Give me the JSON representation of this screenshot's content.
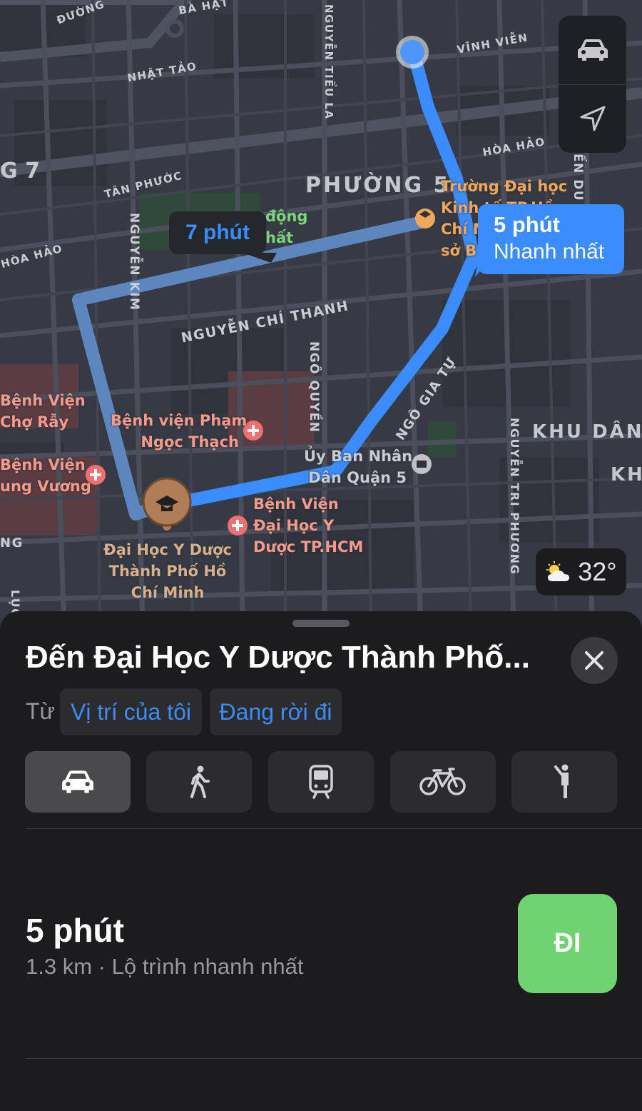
{
  "map": {
    "streets": {
      "duong": "ĐƯỜNG",
      "ba_hat": "BÀ HẠT",
      "nguyen_tieu_la": "NGUYỄN TIỂU LA",
      "vinh_vien": "VĨNH VIỄN",
      "nhat_tao": "NHẬT TẢO",
      "hoa_hao_right": "HÒA HẢO",
      "hoa_hao_left": "HÒA HẢO",
      "tan_phuoc": "TÂN PHƯỚC",
      "nguyen_kim": "NGUYỄN KIM",
      "nguyen_chi_thanh": "NGUYỄN CHÍ THANH",
      "ngo_quyen": "NGÔ QUYỀN",
      "ngo_gia_tu": "NGÔ GIA TỰ",
      "nguyen_tri_phuong": "NGUYỄN TRI PHƯƠNG",
      "en_du": "ẾN DU",
      "ng_left": "NG",
      "luc_left": "LỤC",
      "num7": "G 7"
    },
    "areas": {
      "phuong5": "PHƯỜNG 5",
      "khu_dan_c": "KHU DÂN C",
      "khu": "KHU"
    },
    "pois": {
      "bv_cho_ray": [
        "Bệnh Viện",
        "Chợ Rẫy"
      ],
      "bv_hung_vuong": [
        "Bệnh Viện",
        "ung Vương"
      ],
      "bv_pham_ngoc_thach": [
        "Bệnh viện Phạm",
        "Ngọc Thạch"
      ],
      "ubnd_q5": [
        "Ủy Ban Nhân",
        "Dân Quận 5"
      ],
      "bv_dh_y_duoc": [
        "Bệnh Viện",
        "Đại Học Y",
        "Dược TP.HCM"
      ],
      "destination": [
        "Đại Học Y Dược",
        "Thành Phố Hồ",
        "Chí Minh"
      ],
      "dh_kinh_te": [
        "Trường Đại học",
        "Kinh tế TP.Hồ",
        "Chí M",
        "sở B"
      ],
      "green_area": [
        "động",
        "hất"
      ]
    },
    "routes": {
      "alt_duration": "7 phút",
      "main_duration": "5 phút",
      "main_tag": "Nhanh nhất"
    },
    "controls": {
      "drive_icon": "car-icon",
      "locate_icon": "location-arrow-icon"
    },
    "weather": {
      "temp": "32°",
      "icon": "partly-sunny-icon"
    }
  },
  "sheet": {
    "title": "Đến Đại Học Y Dược Thành Phố...",
    "from_label": "Từ",
    "from_value": "Vị trí của tôi",
    "depart_value": "Đang rời đi",
    "modes": [
      {
        "icon": "car-icon",
        "active": true
      },
      {
        "icon": "walk-icon",
        "active": false
      },
      {
        "icon": "transit-icon",
        "active": false
      },
      {
        "icon": "bicycle-icon",
        "active": false
      },
      {
        "icon": "rideshare-icon",
        "active": false
      }
    ],
    "route": {
      "duration": "5 phút",
      "distance": "1.3 km",
      "separator": "·",
      "description": "Lộ trình nhanh nhất"
    },
    "go_label": "ĐI"
  },
  "colors": {
    "route_blue": "#3a8cff",
    "route_alt": "#6b9bd8",
    "go_green": "#6fd46f",
    "hospital_red": "#f06f6f",
    "destination_brown": "#b07d57"
  }
}
